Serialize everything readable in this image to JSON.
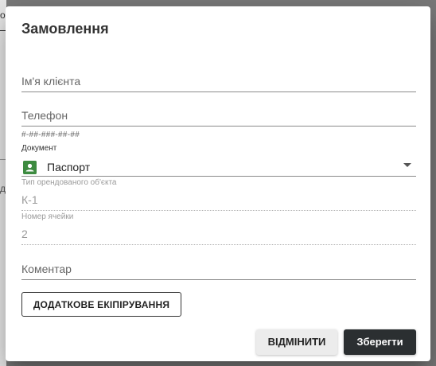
{
  "backdrop": {
    "fragment_top": "о",
    "fragment_mid": "д"
  },
  "dialog": {
    "title": "Замовлення",
    "client_name": {
      "label": "Ім'я клієнта",
      "value": ""
    },
    "phone": {
      "label": "Телефон",
      "value": "",
      "mask_hint": "#-##-###-##-##"
    },
    "document": {
      "label": "Документ",
      "value": "Паспорт",
      "icon": "id-card-icon"
    },
    "object_type": {
      "label": "Тип орендованого об'єкта",
      "value": "К-1"
    },
    "cell_number": {
      "label": "Номер ячейки",
      "value": "2"
    },
    "comment": {
      "label": "Коментар",
      "value": ""
    },
    "extra_equipment_label": "ДОДАТКОВЕ ЕКІПІРУВАННЯ",
    "cancel_label": "ВІДМІНИТИ",
    "save_label": "Зберегти"
  },
  "colors": {
    "primary": "#2b2f31",
    "icon_green": "#3d8b40"
  }
}
